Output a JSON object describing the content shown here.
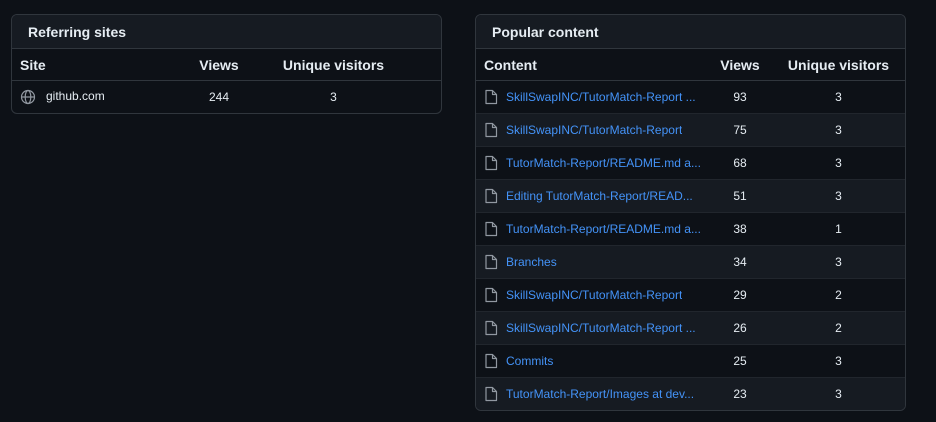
{
  "referring": {
    "title": "Referring sites",
    "headers": [
      "Site",
      "Views",
      "Unique visitors"
    ],
    "rows": [
      {
        "site": "github.com",
        "icon": "globe-icon",
        "views": "244",
        "unique": "3"
      }
    ]
  },
  "popular": {
    "title": "Popular content",
    "headers": [
      "Content",
      "Views",
      "Unique visitors"
    ],
    "rows": [
      {
        "content": "SkillSwapINC/TutorMatch-Report ...",
        "views": "93",
        "unique": "3"
      },
      {
        "content": "SkillSwapINC/TutorMatch-Report",
        "views": "75",
        "unique": "3"
      },
      {
        "content": "TutorMatch-Report/README.md a...",
        "views": "68",
        "unique": "3"
      },
      {
        "content": "Editing TutorMatch-Report/READ...",
        "views": "51",
        "unique": "3"
      },
      {
        "content": "TutorMatch-Report/README.md a...",
        "views": "38",
        "unique": "1"
      },
      {
        "content": "Branches",
        "views": "34",
        "unique": "3"
      },
      {
        "content": "SkillSwapINC/TutorMatch-Report",
        "views": "29",
        "unique": "2"
      },
      {
        "content": "SkillSwapINC/TutorMatch-Report ...",
        "views": "26",
        "unique": "2"
      },
      {
        "content": "Commits",
        "views": "25",
        "unique": "3"
      },
      {
        "content": "TutorMatch-Report/Images at dev...",
        "views": "23",
        "unique": "3"
      }
    ]
  },
  "colors": {
    "background": "#0d1117",
    "link": "#4493f8",
    "border": "#30363d"
  }
}
